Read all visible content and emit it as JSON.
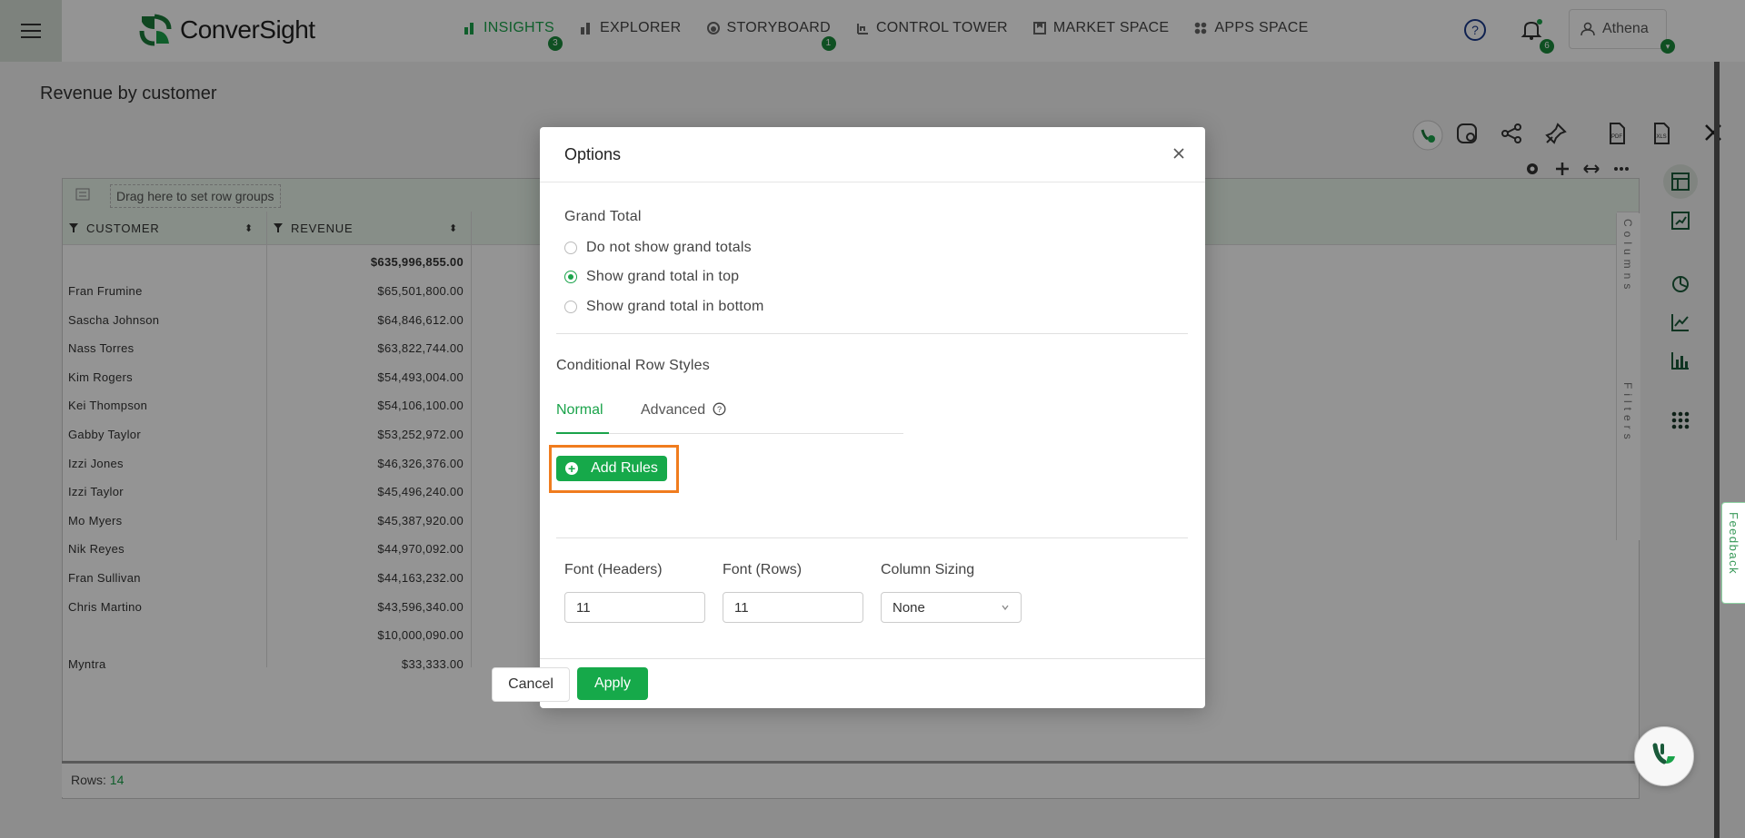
{
  "app": {
    "brand": "ConverSight",
    "nav": [
      {
        "label": "INSIGHTS",
        "badge": "3",
        "active": true,
        "icon": "bar-chart-icon"
      },
      {
        "label": "EXPLORER",
        "badge": "",
        "active": false,
        "icon": "explorer-icon"
      },
      {
        "label": "STORYBOARD",
        "badge": "1",
        "active": false,
        "icon": "storyboard-icon"
      },
      {
        "label": "CONTROL TOWER",
        "badge": "",
        "active": false,
        "icon": "control-tower-icon"
      },
      {
        "label": "MARKET SPACE",
        "badge": "",
        "active": false,
        "icon": "market-space-icon"
      },
      {
        "label": "APPS SPACE",
        "badge": "",
        "active": false,
        "icon": "apps-space-icon"
      }
    ],
    "notifications_count": "6",
    "user_name": "Athena",
    "accent_color": "#1aa34a"
  },
  "page": {
    "title": "Revenue by customer",
    "drag_zone": "Drag here to set row groups",
    "columns": [
      "CUSTOMER",
      "REVENUE"
    ],
    "grand_total": "$635,996,855.00",
    "rows": [
      {
        "customer": "Fran Frumine",
        "revenue": "$65,501,800.00"
      },
      {
        "customer": "Sascha Johnson",
        "revenue": "$64,846,612.00"
      },
      {
        "customer": "Nass Torres",
        "revenue": "$63,822,744.00"
      },
      {
        "customer": "Kim Rogers",
        "revenue": "$54,493,004.00"
      },
      {
        "customer": "Kei Thompson",
        "revenue": "$54,106,100.00"
      },
      {
        "customer": "Gabby Taylor",
        "revenue": "$53,252,972.00"
      },
      {
        "customer": "Izzi Jones",
        "revenue": "$46,326,376.00"
      },
      {
        "customer": "Izzi Taylor",
        "revenue": "$45,496,240.00"
      },
      {
        "customer": "Mo Myers",
        "revenue": "$45,387,920.00"
      },
      {
        "customer": "Nik Reyes",
        "revenue": "$44,970,092.00"
      },
      {
        "customer": "Fran Sullivan",
        "revenue": "$44,163,232.00"
      },
      {
        "customer": "Chris Martino",
        "revenue": "$43,596,340.00"
      },
      {
        "customer": "",
        "revenue": "$10,000,090.00"
      },
      {
        "customer": "Myntra",
        "revenue": "$33,333.00"
      }
    ],
    "rows_label": "Rows:",
    "rows_count": "14",
    "side_columns": "Columns",
    "side_filters": "Filters",
    "feedback": "Feedback"
  },
  "modal": {
    "title": "Options",
    "grand_total_label": "Grand Total",
    "grand_total_options": [
      {
        "label": "Do not show grand totals",
        "selected": false
      },
      {
        "label": "Show grand total in top",
        "selected": true
      },
      {
        "label": "Show grand total in bottom",
        "selected": false
      }
    ],
    "conditional_label": "Conditional Row Styles",
    "tabs": [
      "Normal",
      "Advanced"
    ],
    "add_rules": "Add Rules",
    "font_headers_label": "Font (Headers)",
    "font_headers_value": "11",
    "font_rows_label": "Font (Rows)",
    "font_rows_value": "11",
    "column_sizing_label": "Column Sizing",
    "column_sizing_value": "None",
    "cancel": "Cancel",
    "apply": "Apply"
  }
}
